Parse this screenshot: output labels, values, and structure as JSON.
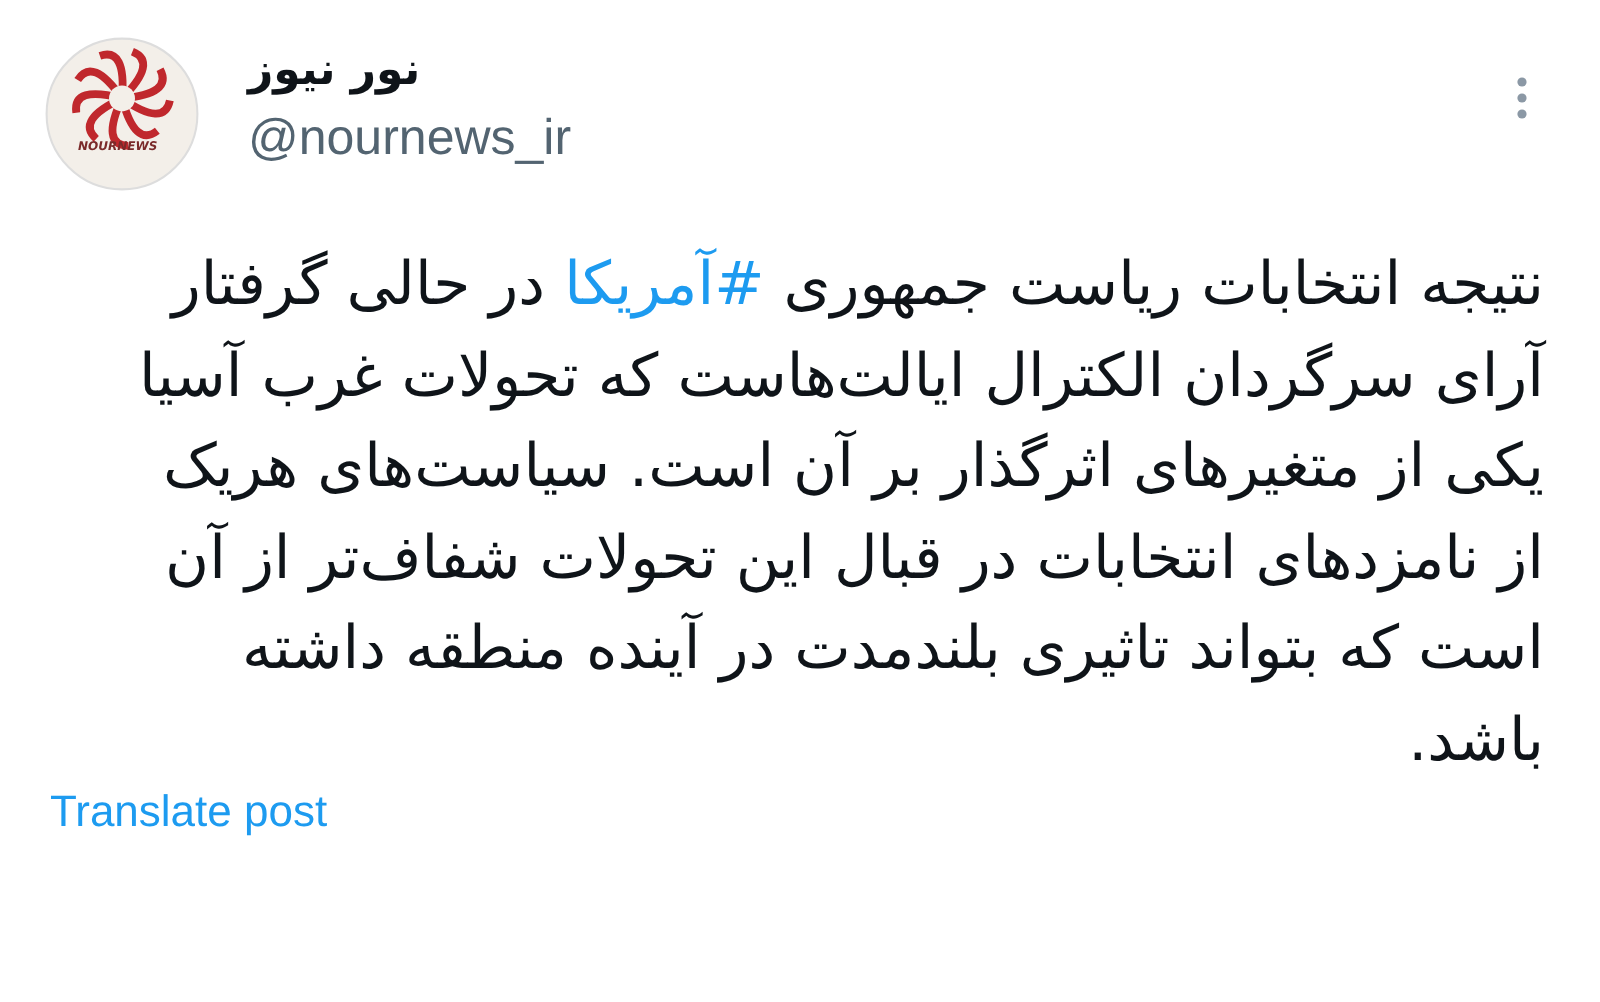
{
  "author": {
    "name": "نور نیوز",
    "handle": "@nournews_ir",
    "logo_text": "NOURNEWS"
  },
  "body": [
    {
      "kind": "text",
      "text": "نتیجه انتخابات ریاست جمهوری "
    },
    {
      "kind": "hashtag",
      "text": "#آمریکا"
    },
    {
      "kind": "text",
      "text": " در حالی گرفتار"
    },
    {
      "kind": "break"
    },
    {
      "kind": "text",
      "text": "آرای سرگردان الکترال ایالت‌هاست که تحولات غرب آسیا"
    },
    {
      "kind": "break"
    },
    {
      "kind": "text",
      "text": "یکی از متغیرهای اثرگذار بر آن است. سیاست‌های هریک"
    },
    {
      "kind": "break"
    },
    {
      "kind": "text",
      "text": "از نامزدهای انتخابات در قبال این تحولات شفاف‌تر از آن"
    },
    {
      "kind": "break"
    },
    {
      "kind": "text",
      "text": "است که بتواند تاثیری بلندمدت در آینده منطقه داشته"
    },
    {
      "kind": "break"
    },
    {
      "kind": "text",
      "text": "باشد."
    }
  ],
  "translate": "Translate post"
}
